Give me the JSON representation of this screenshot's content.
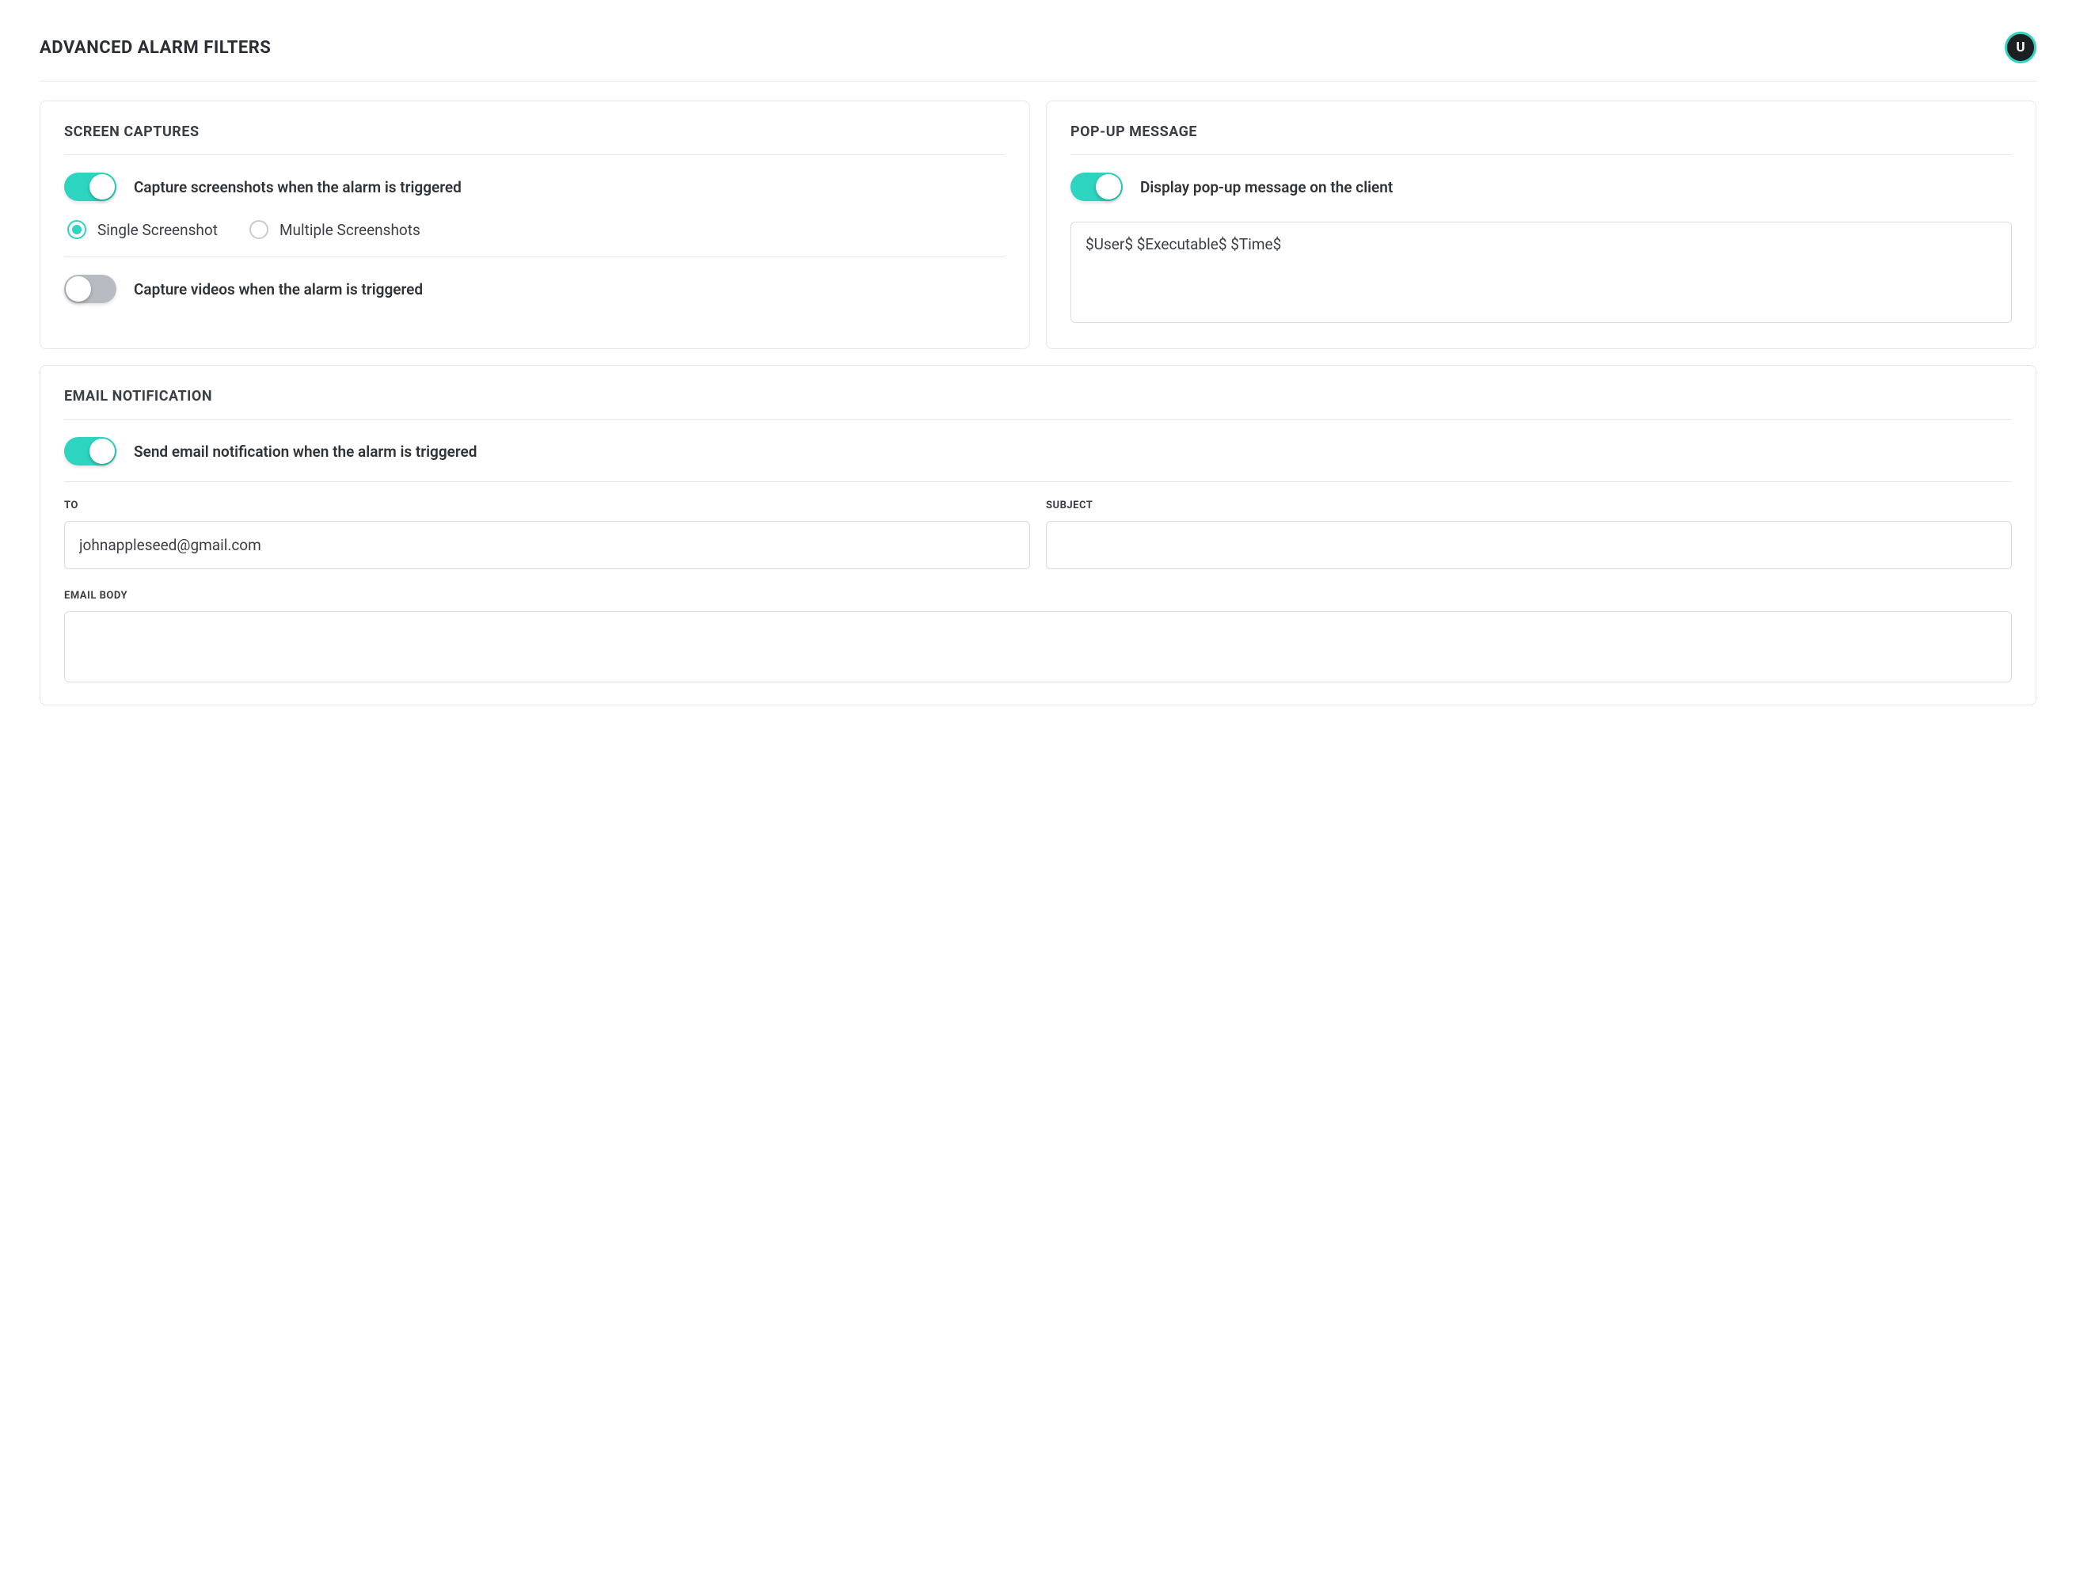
{
  "header": {
    "title": "ADVANCED ALARM FILTERS",
    "avatar_letter": "U"
  },
  "screen_captures": {
    "panel_title": "SCREEN CAPTURES",
    "capture_screenshots_toggle_label": "Capture screenshots when the alarm is triggered",
    "capture_screenshots_enabled": true,
    "radio_single_label": "Single Screenshot",
    "radio_multiple_label": "Multiple Screenshots",
    "radio_selected": "single",
    "capture_videos_toggle_label": "Capture videos when the alarm is triggered",
    "capture_videos_enabled": false
  },
  "popup": {
    "panel_title": "POP-UP MESSAGE",
    "display_popup_toggle_label": "Display pop-up message on the client",
    "display_popup_enabled": true,
    "message_value": "$User$ $Executable$ $Time$"
  },
  "email": {
    "panel_title": "EMAIL NOTIFICATION",
    "send_email_toggle_label": "Send email notification when the alarm is triggered",
    "send_email_enabled": true,
    "to_label": "TO",
    "to_value": "johnappleseed@gmail.com",
    "subject_label": "SUBJECT",
    "subject_value": "",
    "body_label": "EMAIL BODY",
    "body_value": ""
  }
}
